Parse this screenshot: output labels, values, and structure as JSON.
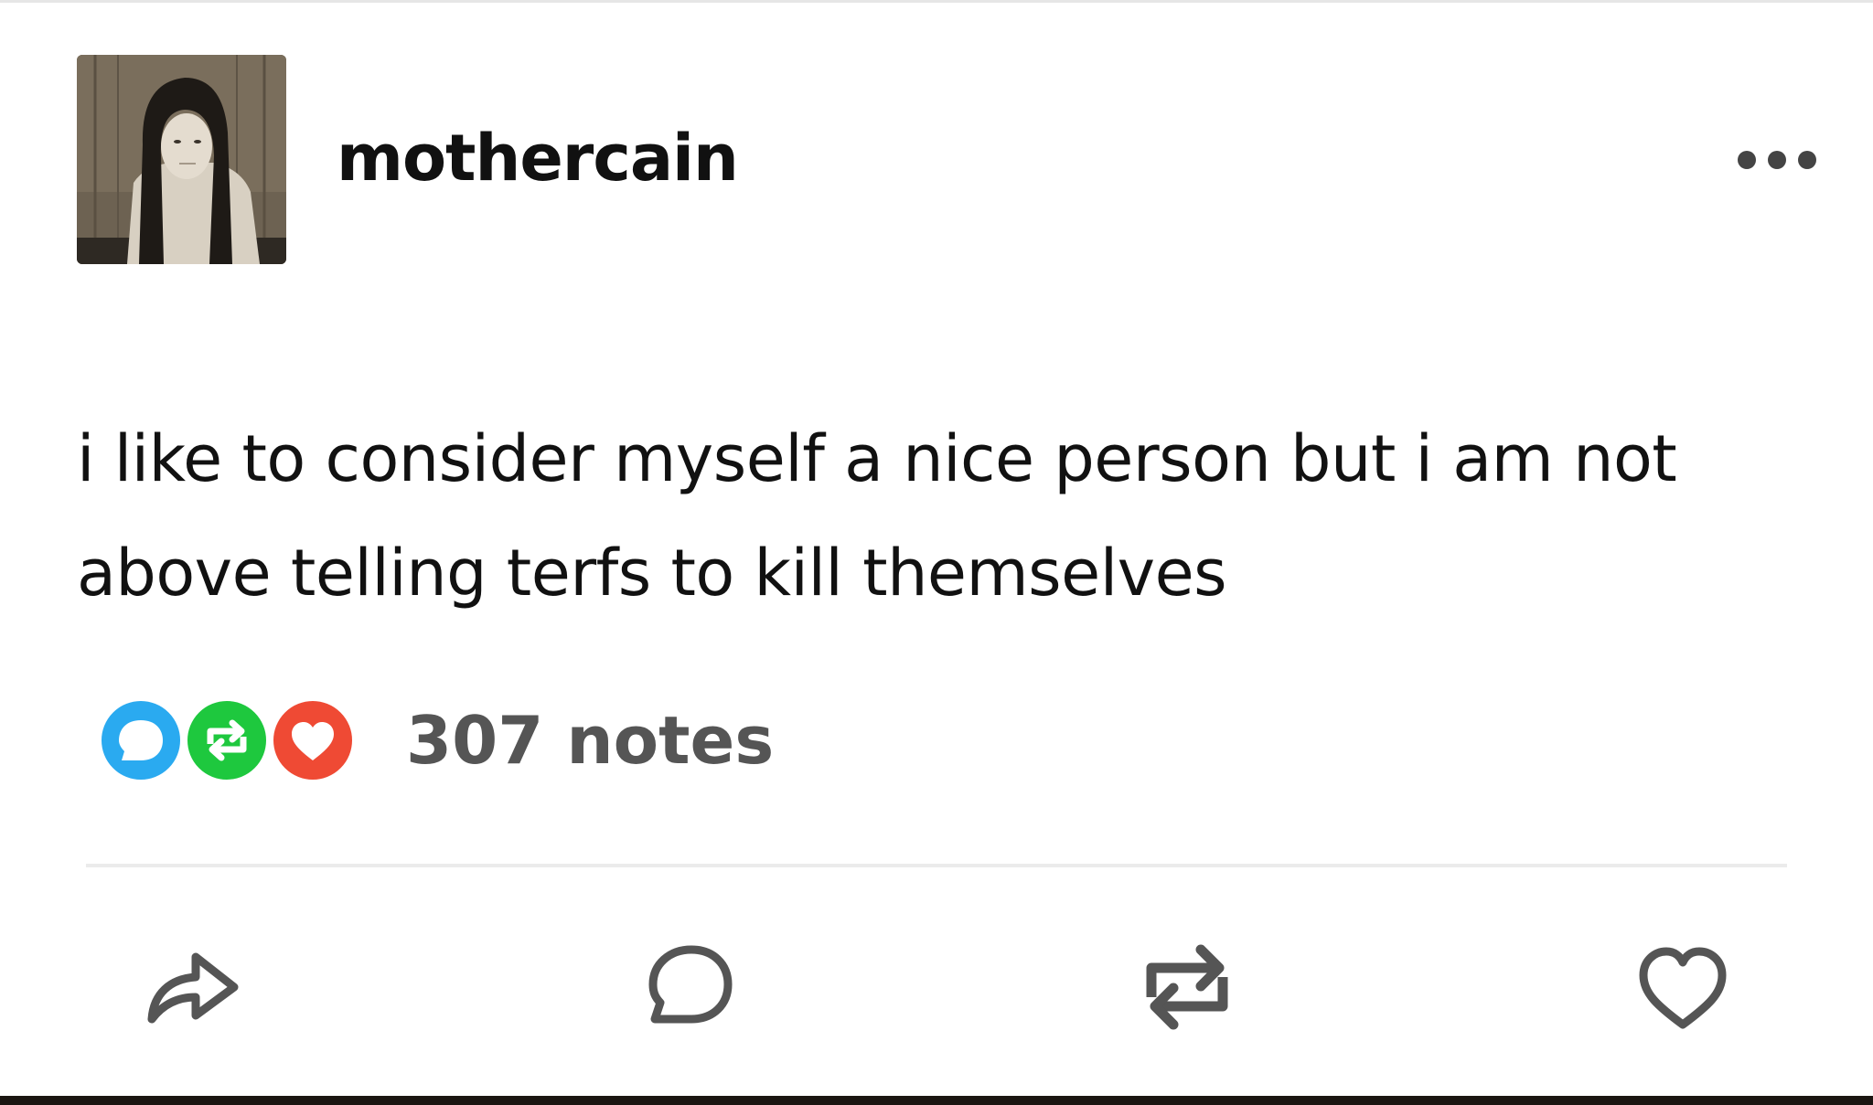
{
  "post": {
    "username": "mothercain",
    "avatar_icon": "profile-photo",
    "text": "i like to consider myself a nice person but i am not above telling terfs to kill themselves",
    "notes": {
      "count_label": "307 notes",
      "icons": [
        "reply-icon",
        "reblog-icon",
        "like-icon"
      ]
    }
  },
  "actions": [
    {
      "name": "share",
      "icon": "share-icon"
    },
    {
      "name": "reply",
      "icon": "reply-icon"
    },
    {
      "name": "reblog",
      "icon": "reblog-icon"
    },
    {
      "name": "like",
      "icon": "heart-icon"
    }
  ],
  "colors": {
    "reply_badge": "#2aaaf0",
    "reblog_badge": "#1ec83e",
    "like_badge": "#ef4a34",
    "action_icon": "#555555",
    "bottom_bar": "#1b1511"
  }
}
